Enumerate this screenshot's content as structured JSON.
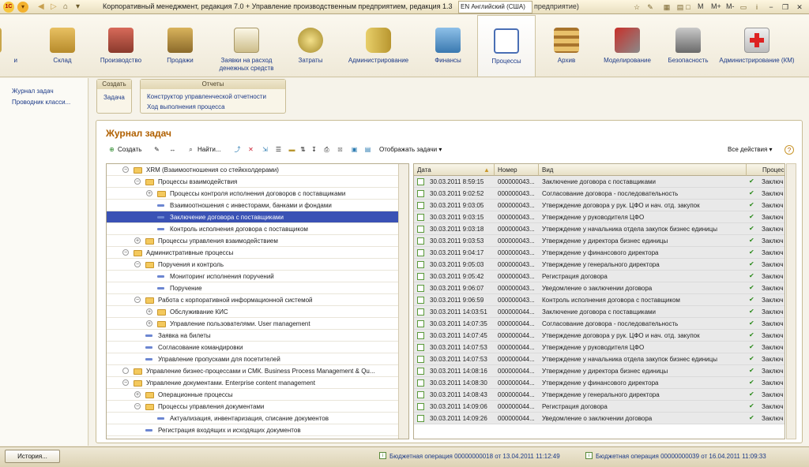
{
  "titlebar": {
    "title": "Корпоративный менеджмент, редакция 7.0 + Управление производственным предприятием, редакция 1.3",
    "language": "EN Английский (США)",
    "title_tail": "предприятие)",
    "calc_buttons": [
      "M",
      "M+",
      "M-"
    ]
  },
  "sections": [
    {
      "label": "Склад",
      "icon": "warehouse-icon"
    },
    {
      "label": "Производство",
      "icon": "factory-icon"
    },
    {
      "label": "Продажи",
      "icon": "truck-icon"
    },
    {
      "label": "Заявки на расход денежных средств",
      "icon": "clipboard-icon"
    },
    {
      "label": "Затраты",
      "icon": "coins-icon"
    },
    {
      "label": "Администрирование",
      "icon": "database-icon"
    },
    {
      "label": "Финансы",
      "icon": "money-icon"
    },
    {
      "label": "Процессы",
      "icon": "process-chart-icon"
    },
    {
      "label": "Архив",
      "icon": "shelves-icon"
    },
    {
      "label": "Моделирование",
      "icon": "tools-icon"
    },
    {
      "label": "Безопасность",
      "icon": "lock-icon"
    },
    {
      "label": "Администрирование (КМ)",
      "icon": "medkit-icon"
    }
  ],
  "left_panel": {
    "items": [
      "Журнал задач",
      "Проводник класси..."
    ]
  },
  "commands": {
    "create_caption": "Создать",
    "create_items": [
      "Задача"
    ],
    "reports_caption": "Отчеты",
    "reports_items": [
      "Конструктор управленческой отчетности",
      "Ход выполнения процесса"
    ]
  },
  "form": {
    "title": "Журнал задач",
    "toolbar": {
      "create": "Создать",
      "find": "Найти...",
      "show_tasks": "Отображать задачи",
      "all_actions": "Все действия"
    }
  },
  "tree": [
    {
      "text": "XRM (Взаимоотношения со стейкхолдерами)",
      "level": 0,
      "toggle": "−",
      "type": "folder"
    },
    {
      "text": "Процессы взаимодействия",
      "level": 1,
      "toggle": "−",
      "type": "folder"
    },
    {
      "text": "Процессы контроля исполнения договоров с поставщиками",
      "level": 2,
      "toggle": "+",
      "type": "folder"
    },
    {
      "text": "Взаимоотношения с инвесторами, банками и фондами",
      "level": 2,
      "toggle": "",
      "type": "leaf"
    },
    {
      "text": "Заключение договора с поставщиками",
      "level": 2,
      "toggle": "",
      "type": "leaf",
      "selected": true
    },
    {
      "text": "Контроль исполнения договора с поставщиком",
      "level": 2,
      "toggle": "",
      "type": "leaf"
    },
    {
      "text": "Процессы управления взаимодействием",
      "level": 1,
      "toggle": "+",
      "type": "folder"
    },
    {
      "text": "Административные процессы",
      "level": 0,
      "toggle": "−",
      "type": "folder"
    },
    {
      "text": "Поручения и контроль",
      "level": 1,
      "toggle": "−",
      "type": "folder"
    },
    {
      "text": "Мониторинг исполнения поручений",
      "level": 2,
      "toggle": "",
      "type": "leaf"
    },
    {
      "text": "Поручение",
      "level": 2,
      "toggle": "",
      "type": "leaf"
    },
    {
      "text": "Работа с корпоративной информационной системой",
      "level": 1,
      "toggle": "−",
      "type": "folder"
    },
    {
      "text": "Обслуживание КИС",
      "level": 2,
      "toggle": "+",
      "type": "folder"
    },
    {
      "text": "Управление пользователями. User management",
      "level": 2,
      "toggle": "+",
      "type": "folder"
    },
    {
      "text": "Заявка на билеты",
      "level": 1,
      "toggle": "",
      "type": "leaf"
    },
    {
      "text": "Согласование командировки",
      "level": 1,
      "toggle": "",
      "type": "leaf"
    },
    {
      "text": "Управление пропусками для посетителей",
      "level": 1,
      "toggle": "",
      "type": "leaf"
    },
    {
      "text": "Управление бизнес-процессами и СМК. Business Process Management & Qu...",
      "level": 0,
      "toggle": "○",
      "type": "folder"
    },
    {
      "text": "Управление документами. Enterprise content management",
      "level": 0,
      "toggle": "−",
      "type": "folder"
    },
    {
      "text": "Операционные процессы",
      "level": 1,
      "toggle": "+",
      "type": "folder"
    },
    {
      "text": "Процессы управления документами",
      "level": 1,
      "toggle": "−",
      "type": "folder"
    },
    {
      "text": "Актуализация, инвентаризация, списание документов",
      "level": 2,
      "toggle": "",
      "type": "leaf"
    },
    {
      "text": "Регистрация входящих и исходящих документов",
      "level": 1,
      "toggle": "",
      "type": "leaf"
    }
  ],
  "grid": {
    "columns": [
      "Дата",
      "Номер",
      "Вид",
      "Процесс"
    ],
    "rows": [
      [
        "30.03.2011 8:59:15",
        "000000043...",
        "Заключение договора с поставщиками",
        "Заключ"
      ],
      [
        "30.03.2011 9:02:52",
        "000000043...",
        "Согласование договора - последовательность",
        "Заключ"
      ],
      [
        "30.03.2011 9:03:05",
        "000000043...",
        "Утверждение договора у рук. ЦФО и нач. отд. закупок",
        "Заключ"
      ],
      [
        "30.03.2011 9:03:15",
        "000000043...",
        "Утверждение у руководителя ЦФО",
        "Заключ"
      ],
      [
        "30.03.2011 9:03:18",
        "000000043...",
        "Утверждение у начальника отдела закупок бизнес единицы",
        "Заключ"
      ],
      [
        "30.03.2011 9:03:53",
        "000000043...",
        "Утверждение у директора бизнес единицы",
        "Заключ"
      ],
      [
        "30.03.2011 9:04:17",
        "000000043...",
        "Утверждение у финансового директора",
        "Заключ"
      ],
      [
        "30.03.2011 9:05:03",
        "000000043...",
        "Утверждение у генерального директора",
        "Заключ"
      ],
      [
        "30.03.2011 9:05:42",
        "000000043...",
        "Регистрация договора",
        "Заключ"
      ],
      [
        "30.03.2011 9:06:07",
        "000000043...",
        "Уведомление о заключении договора",
        "Заключ"
      ],
      [
        "30.03.2011 9:06:59",
        "000000043...",
        "Контроль исполнения договора с поставщиком",
        "Заключ"
      ],
      [
        "30.03.2011 14:03:51",
        "000000044...",
        "Заключение договора с поставщиками",
        "Заключ"
      ],
      [
        "30.03.2011 14:07:35",
        "000000044...",
        "Согласование договора - последовательность",
        "Заключ"
      ],
      [
        "30.03.2011 14:07:45",
        "000000044...",
        "Утверждение договора у рук. ЦФО и нач. отд. закупок",
        "Заключ"
      ],
      [
        "30.03.2011 14:07:53",
        "000000044...",
        "Утверждение у руководителя ЦФО",
        "Заключ"
      ],
      [
        "30.03.2011 14:07:53",
        "000000044...",
        "Утверждение у начальника отдела закупок бизнес единицы",
        "Заключ"
      ],
      [
        "30.03.2011 14:08:16",
        "000000044...",
        "Утверждение у директора бизнес единицы",
        "Заключ"
      ],
      [
        "30.03.2011 14:08:30",
        "000000044...",
        "Утверждение у финансового директора",
        "Заключ"
      ],
      [
        "30.03.2011 14:08:43",
        "000000044...",
        "Утверждение у генерального директора",
        "Заключ"
      ],
      [
        "30.03.2011 14:09:06",
        "000000044...",
        "Регистрация договора",
        "Заключ"
      ],
      [
        "30.03.2011 14:09:26",
        "000000044...",
        "Уведомление о заключении договора",
        "Заключ"
      ]
    ]
  },
  "statusbar": {
    "history": "История...",
    "messages": [
      "Бюджетная операция 00000000018 от 13.04.2011 11:12:49",
      "Бюджетная операция 00000000039 от 16.04.2011 11:09:33"
    ]
  },
  "colors": {
    "selection": "#3a52b5",
    "form_title": "#b06000",
    "link": "#1c3a88"
  }
}
